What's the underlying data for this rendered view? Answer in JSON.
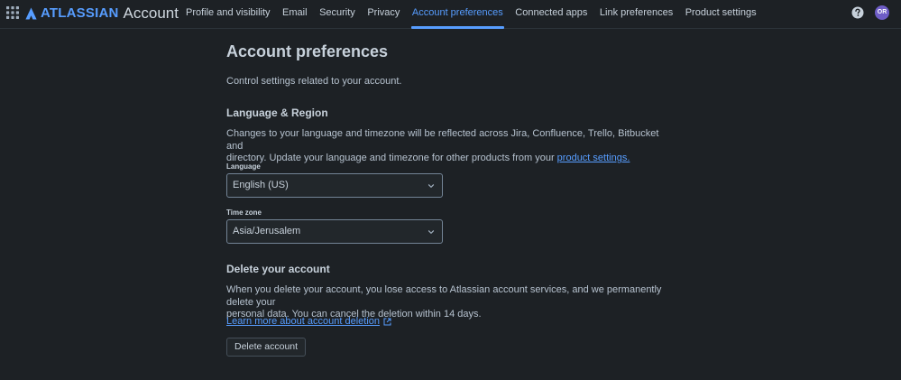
{
  "header": {
    "brand": "ATLASSIAN",
    "product": "Account",
    "nav": [
      {
        "label": "Profile and visibility",
        "active": false
      },
      {
        "label": "Email",
        "active": false
      },
      {
        "label": "Security",
        "active": false
      },
      {
        "label": "Privacy",
        "active": false
      },
      {
        "label": "Account preferences",
        "active": true
      },
      {
        "label": "Connected apps",
        "active": false
      },
      {
        "label": "Link preferences",
        "active": false
      },
      {
        "label": "Product settings",
        "active": false
      }
    ],
    "avatar_initials": "OR",
    "avatar_color": "#6e5dc6",
    "accent_color": "#579dff"
  },
  "page": {
    "title": "Account preferences",
    "description": "Control settings related to your account."
  },
  "language_region": {
    "heading": "Language & Region",
    "text_line1": "Changes to your language and timezone will be reflected across Jira, Confluence, Trello, Bitbucket and",
    "text_line2": "directory. Update your language and timezone for other products from your ",
    "link_text": "product settings.",
    "language_label": "Language",
    "language_value": "English (US)",
    "timezone_label": "Time zone",
    "timezone_value": "Asia/Jerusalem"
  },
  "delete_account": {
    "heading": "Delete your account",
    "text_line1": "When you delete your account, you lose access to Atlassian account services, and we permanently delete your",
    "text_line2": "personal data. You can cancel the deletion within 14 days.",
    "learn_more": "Learn more about account deletion",
    "button_label": "Delete account"
  }
}
